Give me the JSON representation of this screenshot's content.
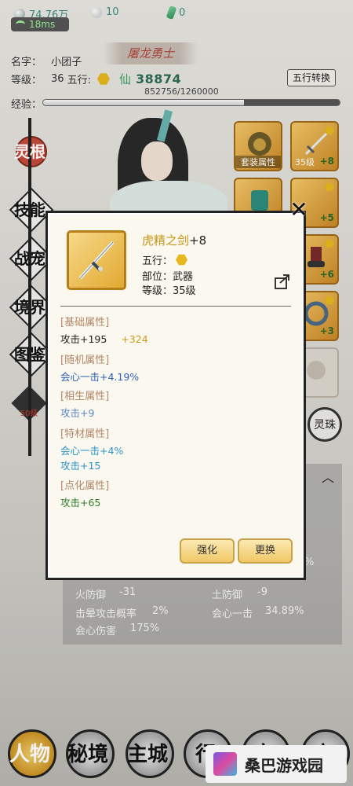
{
  "resources": {
    "silver": "74.76万",
    "pearl": "10",
    "jade": "0",
    "ping": "18ms"
  },
  "player": {
    "title_banner": "屠龙勇士",
    "name_label": "名字：",
    "name": "小团子",
    "level_label": "等级：",
    "level": "36",
    "wuxing_label": "五行:",
    "xian_label": "仙",
    "power": "38874",
    "wuxing_button": "五行转换",
    "exp_label": "经验：",
    "exp_text": "852756/1260000",
    "exp_fraction": 0.677
  },
  "side_menu": {
    "items": [
      "灵根",
      "技能",
      "战宠",
      "境界",
      "图鉴"
    ],
    "badge": "50级"
  },
  "equipment": {
    "slots": [
      {
        "label": "套装属性"
      },
      {
        "level": "35级",
        "plus": "+8"
      },
      {
        "plus": "+5"
      },
      {
        "plus": "+6"
      },
      {
        "plus": "+3"
      }
    ]
  },
  "spirit_orb": "灵珠",
  "stats": {
    "rows": [
      {
        "label": "火防御",
        "value": "-31"
      },
      {
        "label": "土防御",
        "value": "-9"
      },
      {
        "label": "击晕攻击概率",
        "value": "2%"
      },
      {
        "label": "会心一击",
        "value": "34.89%"
      },
      {
        "label": "会心伤害",
        "value": "175%"
      }
    ],
    "partial": "%"
  },
  "item_modal": {
    "name": "虎精之剑",
    "enhance": "+8",
    "wuxing_label": "五行：",
    "slot_label": "部位：",
    "slot_value": "武器",
    "level_label": "等级：",
    "level_value": "35级",
    "sections": {
      "base": {
        "title": "[基础属性]",
        "attr": "攻击+195",
        "bonus": "+324"
      },
      "random": {
        "title": "[随机属性]",
        "attr": "会心一击+4.19%"
      },
      "mutual": {
        "title": "[相生属性]",
        "attr": "攻击+9"
      },
      "material": {
        "title": "[特材属性]",
        "attr1": "会心一击+4%",
        "attr2": "攻击+15"
      },
      "dot": {
        "title": "[点化属性]",
        "attr": "攻击+65"
      }
    },
    "enhance_button": "强化",
    "replace_button": "更换",
    "close_icon": "close-icon",
    "share_icon": "share-icon"
  },
  "bottom_nav": {
    "items": [
      {
        "label": "人物"
      },
      {
        "label": "秘境"
      },
      {
        "label": "主城"
      },
      {
        "label": "行"
      },
      {
        "label": "宝"
      },
      {
        "label": "商"
      }
    ]
  },
  "watermark": "桑巴游戏园",
  "colors": {
    "gold_text": "#c79612",
    "modal_bg": "#fbf8ef",
    "section_title": "#b2876a",
    "power_green": "#2e6d55"
  }
}
